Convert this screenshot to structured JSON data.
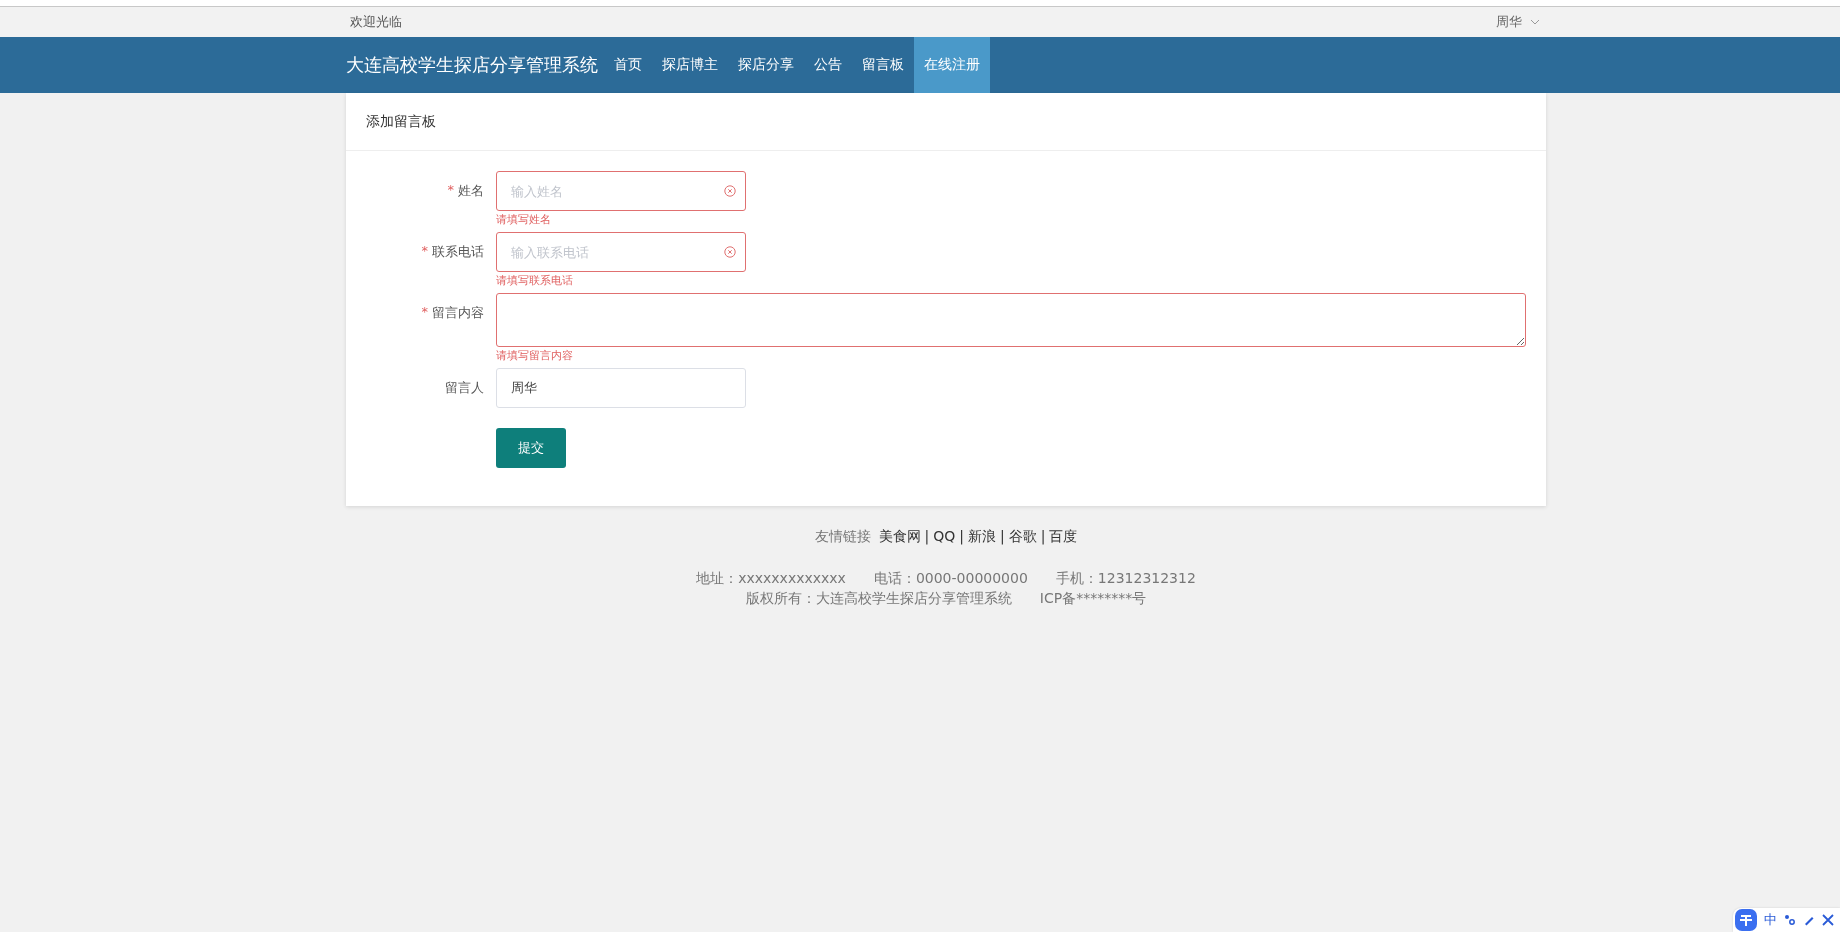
{
  "top_bar": {
    "welcome": "欢迎光临",
    "user": "周华"
  },
  "nav": {
    "title": "大连高校学生探店分享管理系统",
    "items": [
      {
        "label": "首页",
        "selected": false
      },
      {
        "label": "探店博主",
        "selected": false
      },
      {
        "label": "探店分享",
        "selected": false
      },
      {
        "label": "公告",
        "selected": false
      },
      {
        "label": "留言板",
        "selected": false
      },
      {
        "label": "在线注册",
        "selected": true
      }
    ]
  },
  "form": {
    "title": "添加留言板",
    "fields": [
      {
        "kind": "input",
        "label": "姓名",
        "required_mark": "*",
        "placeholder": "输入姓名",
        "clearable": true,
        "error": "请填写姓名"
      },
      {
        "kind": "input",
        "label": "联系电话",
        "required_mark": "*",
        "placeholder": "输入联系电话",
        "clearable": true,
        "error": "请填写联系电话"
      },
      {
        "kind": "textarea",
        "label": "留言内容",
        "required_mark": "*",
        "error": "请填写留言内容"
      },
      {
        "kind": "input",
        "label": "留言人",
        "value": "周华"
      }
    ],
    "submit": "提交"
  },
  "footer": {
    "links_label": "友情链接",
    "links": [
      "美食网",
      "QQ",
      "新浪",
      "谷歌",
      "百度"
    ],
    "separator": "|",
    "address": "地址：xxxxxxxxxxxxx",
    "phone": "电话：0000-00000000",
    "mobile": "手机：12312312312",
    "copyright": "版权所有：大连高校学生探店分享管理系统",
    "icp": "ICP备********号"
  },
  "ime_toolbar": {
    "mode": "中"
  }
}
